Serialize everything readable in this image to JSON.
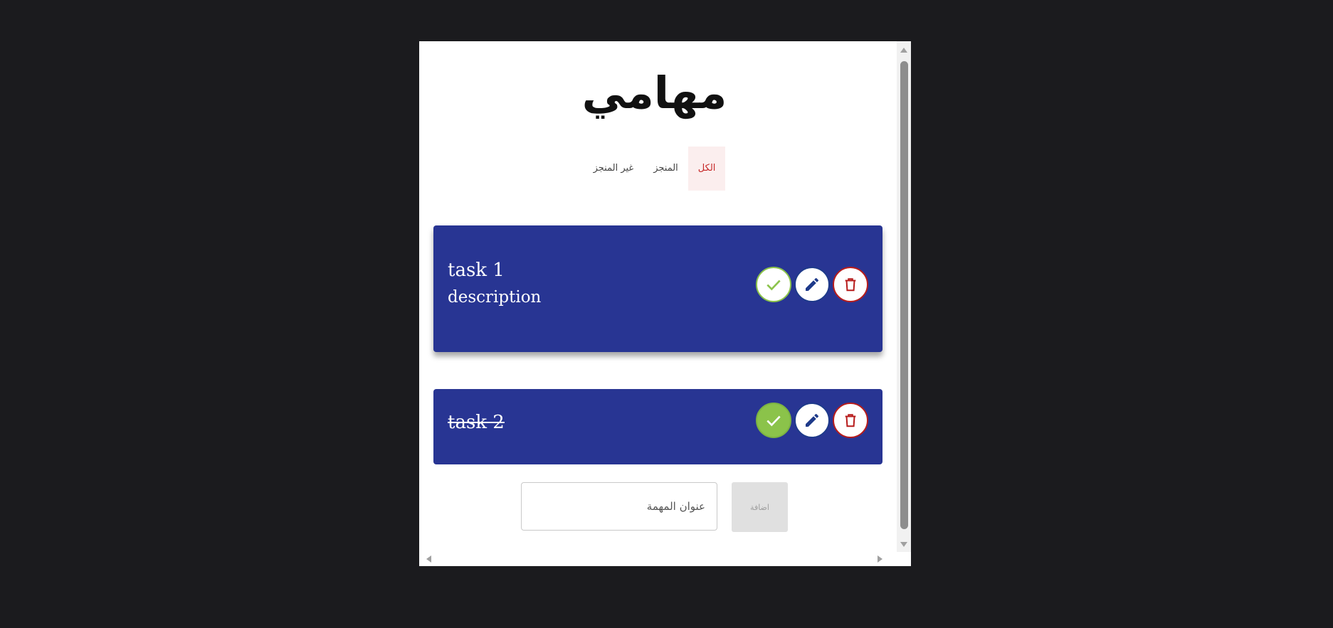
{
  "app": {
    "title": "مهامي"
  },
  "tabs": [
    {
      "label": "الكل",
      "active": true
    },
    {
      "label": "المنجز",
      "active": false
    },
    {
      "label": "غير المنجز",
      "active": false
    }
  ],
  "tasks": [
    {
      "title": "task 1",
      "description": "description",
      "done": false
    },
    {
      "title": "task 2",
      "description": "",
      "done": true
    }
  ],
  "add_form": {
    "placeholder": "عنوان المهمة",
    "button_label": "اضافة"
  },
  "colors": {
    "task_bg": "#283593",
    "done_green": "#8bc34a",
    "delete_red": "#b71c1c",
    "edit_blue": "#1e3a8a",
    "active_tab": "#c62828"
  },
  "icons": {
    "complete": "check-icon",
    "edit": "pencil-icon",
    "delete": "trash-icon"
  }
}
